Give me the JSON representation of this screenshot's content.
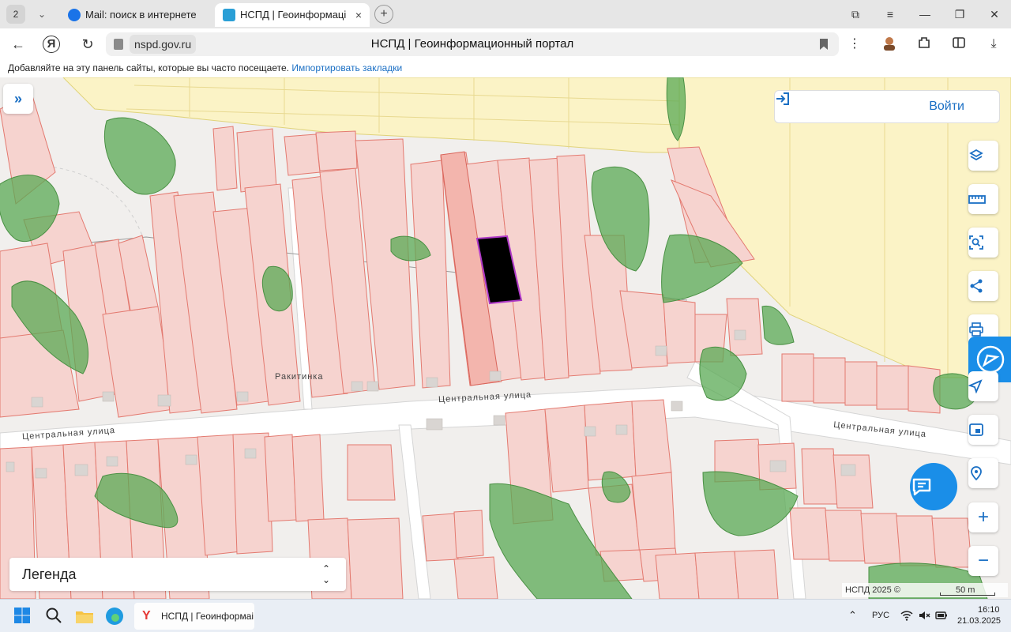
{
  "browser": {
    "tab_count": "2",
    "tabs": [
      {
        "label": "Mail: поиск в интернете"
      },
      {
        "label": "НСПД | Геоинформаці",
        "close": "×"
      }
    ],
    "new_tab": "+",
    "window": {
      "minimize": "—",
      "maximize": "❐",
      "close": "✕",
      "collections": "⧉",
      "menu": "≡"
    },
    "url_domain": "nspd.gov.ru",
    "page_title": "НСПД | Геоинформационный портал",
    "bookmarks_hint": "Добавляйте на эту панель сайты, которые вы часто посещаете.",
    "bookmarks_link": "Импортировать закладки"
  },
  "map": {
    "login_label": "Войти",
    "expand_label": "»",
    "settlement_label": "Ракитинка",
    "street_labels": [
      "Центральная улица",
      "Центральная улица",
      "Центральная улица"
    ],
    "legend_label": "Легенда",
    "attribution": "НСПД 2025 ©",
    "scale_label": "50 m",
    "zoom_in": "+",
    "zoom_out": "−",
    "colors": {
      "parcel_fill": "#f6d3cf",
      "parcel_stroke": "#e3796f",
      "green": "#5aa954",
      "selected": "#000000",
      "selected_outline": "#b03ac8",
      "zone_fill": "#fbf3c6",
      "accent": "#1a6fc4"
    }
  },
  "taskbar": {
    "app_label": "НСПД | Геоинформаі",
    "language": "РУС",
    "time": "16:10",
    "date": "21.03.2025"
  }
}
